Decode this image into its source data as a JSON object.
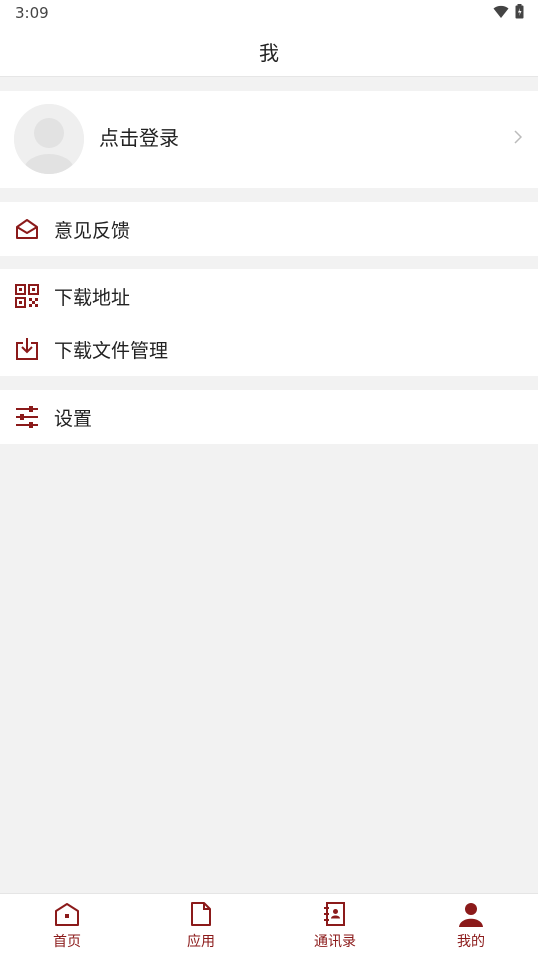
{
  "status_bar": {
    "time": "3:09",
    "icons": [
      "wifi-icon",
      "battery-icon"
    ]
  },
  "header": {
    "title": "我"
  },
  "profile": {
    "login_label": "点击登录"
  },
  "menu": {
    "feedback": "意见反馈",
    "download_address": "下载地址",
    "download_files": "下载文件管理",
    "settings": "设置"
  },
  "bottom_nav": {
    "tabs": [
      {
        "label": "首页",
        "icon": "home-icon",
        "active": false
      },
      {
        "label": "应用",
        "icon": "document-icon",
        "active": false
      },
      {
        "label": "通讯录",
        "icon": "contacts-icon",
        "active": false
      },
      {
        "label": "我的",
        "icon": "person-icon",
        "active": true
      }
    ]
  },
  "colors": {
    "accent": "#8b1a1a",
    "background": "#f2f2f2",
    "card": "#ffffff"
  }
}
